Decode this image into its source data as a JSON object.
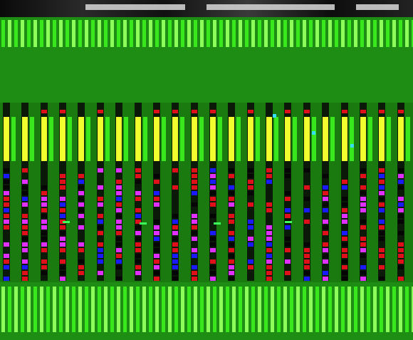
{
  "game": {
    "screen": "sequencer-grid",
    "columns": 22
  },
  "colors": {
    "field": "#1f8a12",
    "bright_green": "#39e81c",
    "pale_green": "#8cff5a",
    "yellow": "#f2ff2e",
    "red": "#e0101a",
    "blue": "#1a1aff",
    "magenta": "#e030ff",
    "cyan": "#35e0ff",
    "black": "#050505"
  },
  "legend_colors": [
    "red",
    "blue",
    "magenta",
    "black"
  ],
  "icons": {
    "highlight": "cursor-marker-icon"
  }
}
